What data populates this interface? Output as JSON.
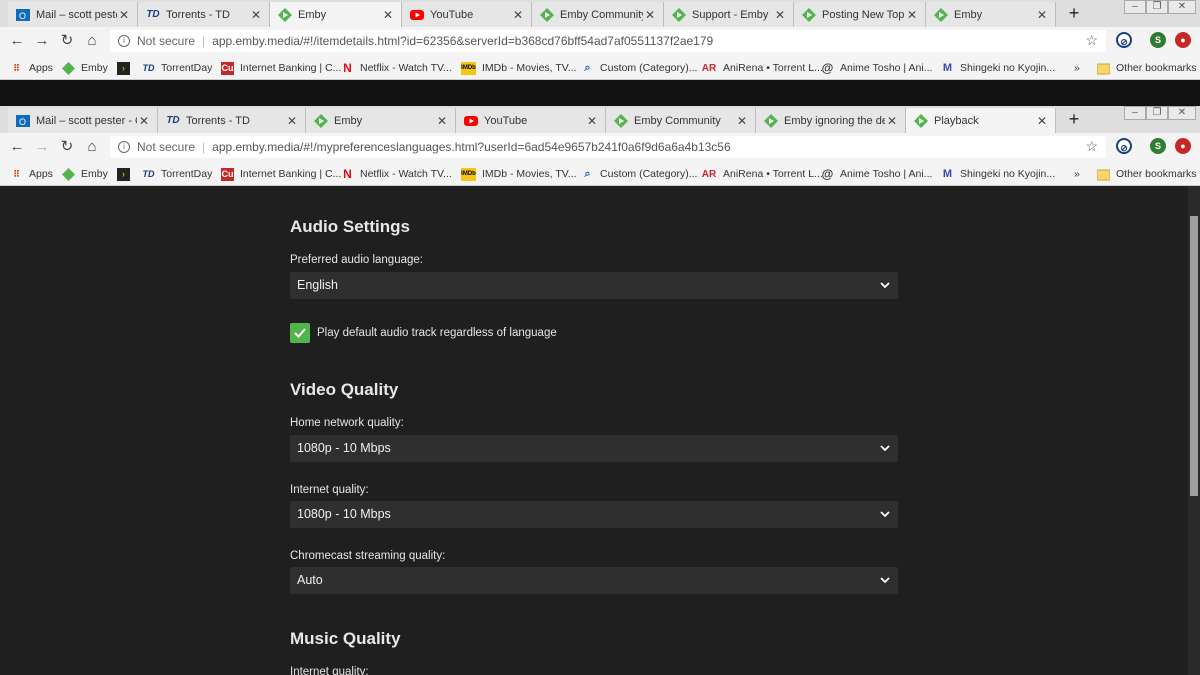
{
  "back_window": {
    "tabs": [
      {
        "title": "Mail – scott pester",
        "icon": "outlook-icon"
      },
      {
        "title": "Torrents - TD",
        "icon": "td-icon"
      },
      {
        "title": "Emby",
        "icon": "emby-icon"
      },
      {
        "title": "YouTube",
        "icon": "youtube-icon"
      },
      {
        "title": "Emby Community",
        "icon": "emby-icon"
      },
      {
        "title": "Support - Emby",
        "icon": "emby-icon"
      },
      {
        "title": "Posting New Topic",
        "icon": "emby-icon"
      },
      {
        "title": "Emby",
        "icon": "emby-icon"
      }
    ],
    "active_tab": 2,
    "security": "Not secure",
    "url": "app.emby.media/#!/itemdetails.html?id=62356&serverId=b368cd76bff54ad7af0551137f2ae179"
  },
  "front_window": {
    "tabs": [
      {
        "title": "Mail – scott pester - Out",
        "icon": "outlook-icon"
      },
      {
        "title": "Torrents - TD",
        "icon": "td-icon"
      },
      {
        "title": "Emby",
        "icon": "emby-icon"
      },
      {
        "title": "YouTube",
        "icon": "youtube-icon"
      },
      {
        "title": "Emby Community",
        "icon": "emby-icon"
      },
      {
        "title": "Emby ignoring the defa",
        "icon": "emby-icon"
      },
      {
        "title": "Playback",
        "icon": "emby-icon"
      }
    ],
    "active_tab": 6,
    "security": "Not secure",
    "url": "app.emby.media/#!/mypreferenceslanguages.html?userId=6ad54e9657b241f0a6f9d6a6a4b13c56"
  },
  "bookmarks": {
    "items": [
      {
        "label": "Apps",
        "icon": "apps-grid-icon"
      },
      {
        "label": "Emby",
        "icon": "emby-icon"
      },
      {
        "label": "",
        "icon": "plex-icon"
      },
      {
        "label": "TorrentDay",
        "icon": "td-icon"
      },
      {
        "label": "Internet Banking | C...",
        "icon": "bank-icon"
      },
      {
        "label": "Netflix - Watch TV...",
        "icon": "netflix-icon"
      },
      {
        "label": "IMDb - Movies, TV...",
        "icon": "imdb-icon"
      },
      {
        "label": "Custom (Category)...",
        "icon": "search-icon"
      },
      {
        "label": "AniRena • Torrent L...",
        "icon": "anirena-icon"
      },
      {
        "label": "Anime Tosho | Ani...",
        "icon": "at-icon"
      },
      {
        "label": "Shingeki no Kyojin...",
        "icon": "m-icon"
      }
    ],
    "overflow": "»",
    "other": "Other bookmarks"
  },
  "extensions": {
    "avatar_letter": "S"
  },
  "settings": {
    "audio": {
      "title": "Audio Settings",
      "preferred_label": "Preferred audio language:",
      "preferred_value": "English",
      "checkbox_label": "Play default audio track regardless of language",
      "checkbox_checked": true
    },
    "video": {
      "title": "Video Quality",
      "home_label": "Home network quality:",
      "home_value": "1080p - 10 Mbps",
      "internet_label": "Internet quality:",
      "internet_value": "1080p - 10 Mbps",
      "chromecast_label": "Chromecast streaming quality:",
      "chromecast_value": "Auto"
    },
    "music": {
      "title": "Music Quality",
      "internet_label": "Internet quality:"
    }
  },
  "colors": {
    "accent": "#52b54b",
    "background": "#1f1f1f",
    "select_bg": "#2f2f2f"
  }
}
